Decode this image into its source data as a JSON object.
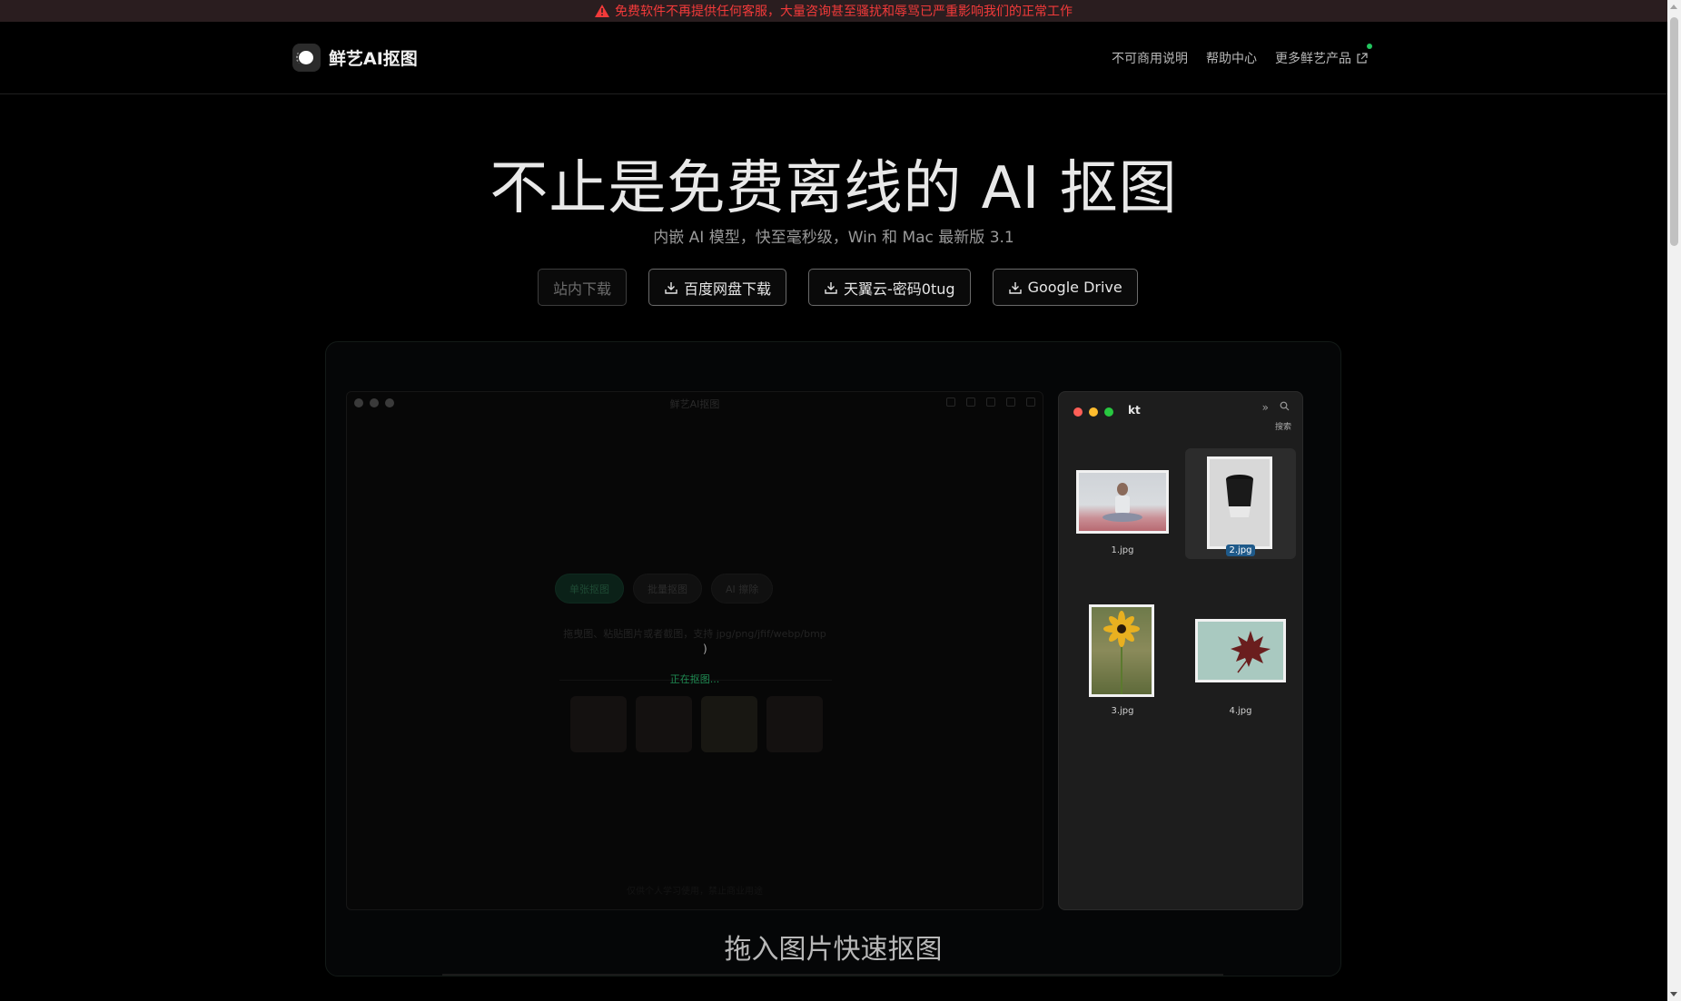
{
  "banner": {
    "text": "免费软件不再提供任何客服，大量咨询甚至骚扰和辱骂已严重影响我们的正常工作",
    "color": "#f23a3a"
  },
  "header": {
    "brand": "鲜艺AI抠图",
    "nav": [
      {
        "label": "不可商用说明"
      },
      {
        "label": "帮助中心"
      },
      {
        "label": "更多鲜艺产品",
        "icon": "external-link-icon"
      }
    ]
  },
  "hero": {
    "title": "不止是免费离线的 AI 抠图",
    "subtitle": "内嵌 AI 模型，快至毫秒级，Win 和 Mac 最新版 3.1",
    "buttons": [
      {
        "label": "站内下载",
        "disabled": true
      },
      {
        "label": "百度网盘下载",
        "icon": "download-icon"
      },
      {
        "label": "天翼云-密码0tug",
        "icon": "download-icon"
      },
      {
        "label": "Google Drive",
        "icon": "download-icon"
      }
    ]
  },
  "app_window": {
    "title": "鲜艺AI抠图",
    "buttons": [
      "单张抠图",
      "批量抠图",
      "AI 擦除"
    ],
    "hint": "拖曳图、粘贴图片或者截图，支持 jpg/png/jfif/webp/bmp",
    "caret": ")",
    "processing": "正在抠图...",
    "footer": "仅供个人学习使用，禁止商业用途"
  },
  "finder": {
    "title": "kt",
    "search_label": "搜索",
    "files": [
      {
        "name": "1.jpg",
        "selected": false
      },
      {
        "name": "2.jpg",
        "selected": true
      },
      {
        "name": "3.jpg",
        "selected": false
      },
      {
        "name": "4.jpg",
        "selected": false
      }
    ]
  },
  "showcase": {
    "caption": "拖入图片快速抠图"
  },
  "colors": {
    "accent_green": "#22c55e",
    "banner_red": "#f23a3a",
    "selection_blue": "#1f5a8a"
  }
}
